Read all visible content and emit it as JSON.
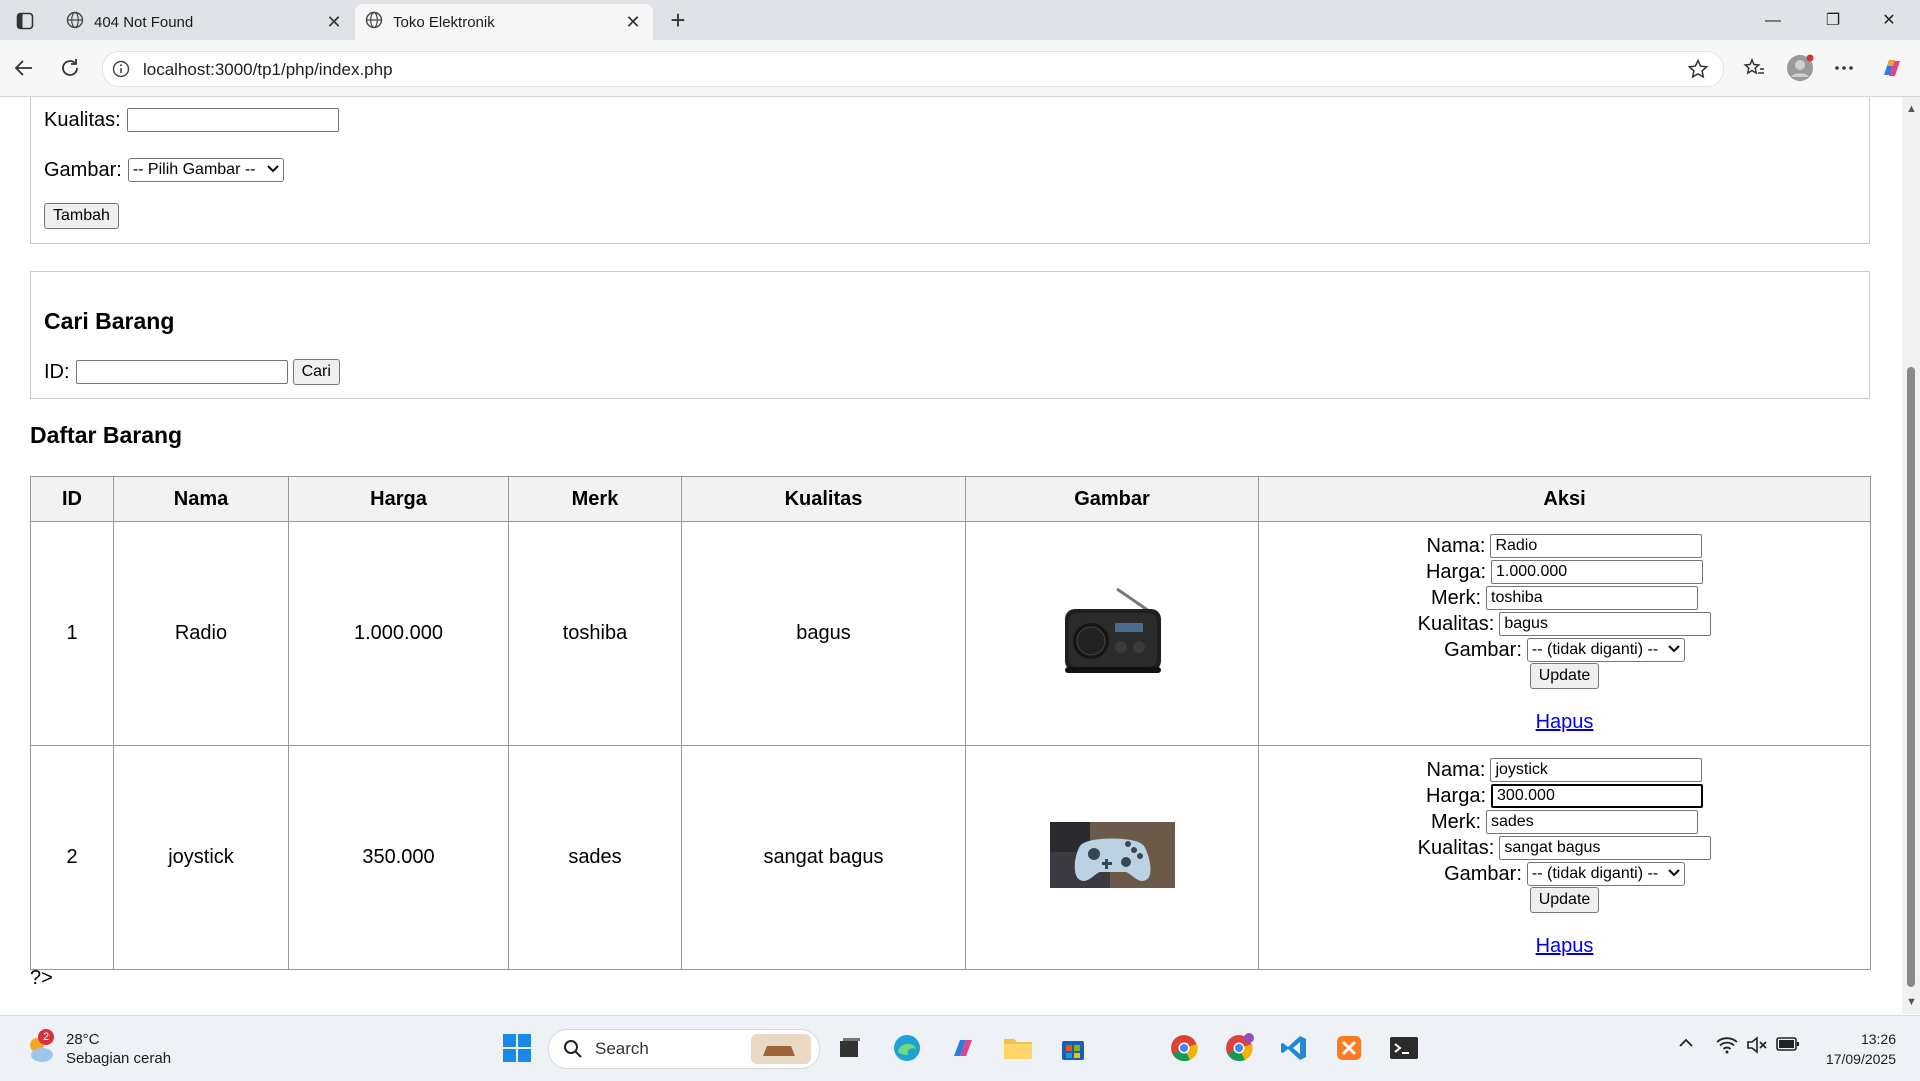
{
  "browser": {
    "tabs": [
      {
        "title": "404 Not Found",
        "active": false
      },
      {
        "title": "Toko Elektronik",
        "active": true
      }
    ],
    "url": "localhost:3000/tp1/php/index.php"
  },
  "add_form": {
    "kualitas_label": "Kualitas:",
    "kualitas_value": "",
    "gambar_label": "Gambar:",
    "gambar_selected": "-- Pilih Gambar --",
    "submit_label": "Tambah"
  },
  "search": {
    "title": "Cari Barang",
    "id_label": "ID:",
    "id_value": "",
    "button_label": "Cari"
  },
  "list": {
    "title": "Daftar Barang",
    "columns": [
      "ID",
      "Nama",
      "Harga",
      "Merk",
      "Kualitas",
      "Gambar",
      "Aksi"
    ],
    "rows": [
      {
        "id": "1",
        "nama": "Radio",
        "harga": "1.000.000",
        "merk": "toshiba",
        "kualitas": "bagus",
        "image": "radio-image",
        "edit": {
          "nama_label": "Nama:",
          "nama": "Radio",
          "harga_label": "Harga:",
          "harga": "1.000.000",
          "merk_label": "Merk:",
          "merk": "toshiba",
          "kualitas_label": "Kualitas:",
          "kualitas": "bagus",
          "gambar_label": "Gambar:",
          "gambar": "-- (tidak diganti) --",
          "update_label": "Update",
          "hapus_label": "Hapus"
        }
      },
      {
        "id": "2",
        "nama": "joystick",
        "harga": "350.000",
        "merk": "sades",
        "kualitas": "sangat bagus",
        "image": "joystick-image",
        "edit": {
          "nama_label": "Nama:",
          "nama": "joystick",
          "harga_label": "Harga:",
          "harga": "300.000",
          "merk_label": "Merk:",
          "merk": "sades",
          "kualitas_label": "Kualitas:",
          "kualitas": "sangat bagus",
          "gambar_label": "Gambar:",
          "gambar": "-- (tidak diganti) --",
          "update_label": "Update",
          "hapus_label": "Hapus"
        }
      }
    ],
    "trailing_text": "?>"
  },
  "taskbar": {
    "weather_badge": "2",
    "temperature": "28°C",
    "condition": "Sebagian cerah",
    "search_label": "Search",
    "time": "13:26",
    "date": "17/09/2025"
  }
}
